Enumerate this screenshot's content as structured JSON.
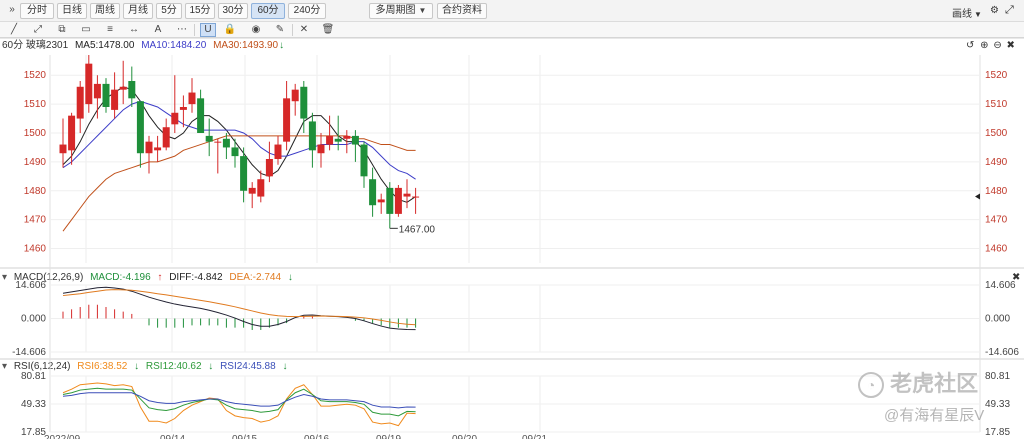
{
  "toolbar": {
    "collapse_icon": "double-chevron-right-icon",
    "periods": [
      "分时",
      "日线",
      "周线",
      "月线",
      "5分",
      "15分",
      "30分",
      "60分",
      "240分"
    ],
    "active_period": "60分",
    "multi_cycle_label": "多周期图",
    "contract_info_label": "合约资料",
    "draw_label": "画线",
    "right_icons": [
      "settings-icon",
      "expand-icon"
    ]
  },
  "drawing_tools": [
    {
      "name": "line-tool-icon",
      "glyph": "╱"
    },
    {
      "name": "ray-tool-icon",
      "glyph": "⤢"
    },
    {
      "name": "channel-tool-icon",
      "glyph": "⧉"
    },
    {
      "name": "rect-tool-icon",
      "glyph": "▭"
    },
    {
      "name": "fib-tool-icon",
      "glyph": "≡"
    },
    {
      "name": "width-tool-icon",
      "glyph": "↔"
    },
    {
      "name": "text-tool-icon",
      "glyph": "A"
    },
    {
      "name": "more-tool-icon",
      "glyph": "⋯"
    },
    {
      "name": "magnet-tool-icon",
      "glyph": "U"
    },
    {
      "name": "lock-tool-icon",
      "glyph": "🔒"
    },
    {
      "name": "eye-tool-icon",
      "glyph": "◉"
    },
    {
      "name": "pen-tool-icon",
      "glyph": "✎"
    },
    {
      "name": "hide-tool-icon",
      "glyph": "✕"
    },
    {
      "name": "delete-tool-icon",
      "glyph": "🗑"
    }
  ],
  "main_panel": {
    "label": "60分 玻璃2301",
    "ma5": "MA5:1478.00",
    "ma10": "MA10:1484.20",
    "ma30": "MA30:1493.90",
    "min_label": "1467.00"
  },
  "macd_panel": {
    "label": "MACD(12,26,9)",
    "macd": "MACD:-4.196",
    "diff": "DIFF:-4.842",
    "dea": "DEA:-2.744",
    "ticks": [
      "14.606",
      "0.000",
      "-14.606"
    ]
  },
  "rsi_panel": {
    "label": "RSI(6,12,24)",
    "rsi6": "RSI6:38.52",
    "rsi12": "RSI12:40.62",
    "rsi24": "RSI24:45.88",
    "ticks": [
      "80.81",
      "49.33",
      "17.85"
    ]
  },
  "watermark": {
    "brand": "老虎社区",
    "user": "@有海有星辰V"
  },
  "colors": {
    "up": "#d62828",
    "down": "#1e8f3a",
    "ma5": "#222222",
    "ma10": "#3d3dc8",
    "ma30": "#c0501a",
    "diff": "#222233",
    "dea": "#e07a1f",
    "rsi6": "#f08a1c",
    "rsi12": "#2e9a3a",
    "rsi24": "#3b4fb8"
  },
  "chart_data": [
    {
      "type": "candlestick",
      "title": "60分 玻璃2301",
      "y_ticks": [
        1460,
        1470,
        1480,
        1490,
        1500,
        1510,
        1520
      ],
      "ylim": [
        1455,
        1527
      ],
      "grid": true,
      "x_tick_labels": [
        "2022/09",
        "09/14",
        "09/15",
        "09/16",
        "09/19",
        "09/20",
        "09/21"
      ],
      "candles": [
        {
          "o": 1493,
          "h": 1505,
          "l": 1488,
          "c": 1496
        },
        {
          "o": 1494,
          "h": 1507,
          "l": 1489,
          "c": 1506
        },
        {
          "o": 1505,
          "h": 1518,
          "l": 1500,
          "c": 1516
        },
        {
          "o": 1510,
          "h": 1527,
          "l": 1507,
          "c": 1524
        },
        {
          "o": 1512,
          "h": 1520,
          "l": 1505,
          "c": 1517
        },
        {
          "o": 1517,
          "h": 1519,
          "l": 1507,
          "c": 1509
        },
        {
          "o": 1508,
          "h": 1521,
          "l": 1505,
          "c": 1515
        },
        {
          "o": 1515,
          "h": 1525,
          "l": 1510,
          "c": 1516
        },
        {
          "o": 1518,
          "h": 1523,
          "l": 1509,
          "c": 1512
        },
        {
          "o": 1511,
          "h": 1508,
          "l": 1488,
          "c": 1493
        },
        {
          "o": 1493,
          "h": 1499,
          "l": 1486,
          "c": 1497
        },
        {
          "o": 1494,
          "h": 1499,
          "l": 1490,
          "c": 1495
        },
        {
          "o": 1495,
          "h": 1505,
          "l": 1494,
          "c": 1502
        },
        {
          "o": 1503,
          "h": 1520,
          "l": 1500,
          "c": 1507
        },
        {
          "o": 1508,
          "h": 1513,
          "l": 1502,
          "c": 1509
        },
        {
          "o": 1510,
          "h": 1519,
          "l": 1507,
          "c": 1514
        },
        {
          "o": 1512,
          "h": 1515,
          "l": 1500,
          "c": 1500
        },
        {
          "o": 1499,
          "h": 1505,
          "l": 1492,
          "c": 1497
        },
        {
          "o": 1497,
          "h": 1498,
          "l": 1486,
          "c": 1497
        },
        {
          "o": 1498,
          "h": 1500,
          "l": 1491,
          "c": 1495
        },
        {
          "o": 1495,
          "h": 1498,
          "l": 1488,
          "c": 1492
        },
        {
          "o": 1492,
          "h": 1495,
          "l": 1476,
          "c": 1480
        },
        {
          "o": 1479,
          "h": 1483,
          "l": 1474,
          "c": 1481
        },
        {
          "o": 1478,
          "h": 1487,
          "l": 1476,
          "c": 1484
        },
        {
          "o": 1485,
          "h": 1497,
          "l": 1483,
          "c": 1491
        },
        {
          "o": 1491,
          "h": 1499,
          "l": 1489,
          "c": 1496
        },
        {
          "o": 1497,
          "h": 1518,
          "l": 1494,
          "c": 1512
        },
        {
          "o": 1511,
          "h": 1517,
          "l": 1506,
          "c": 1515
        },
        {
          "o": 1516,
          "h": 1518,
          "l": 1500,
          "c": 1505
        },
        {
          "o": 1504,
          "h": 1507,
          "l": 1488,
          "c": 1494
        },
        {
          "o": 1493,
          "h": 1500,
          "l": 1488,
          "c": 1496
        },
        {
          "o": 1496,
          "h": 1506,
          "l": 1494,
          "c": 1499
        },
        {
          "o": 1498,
          "h": 1506,
          "l": 1494,
          "c": 1497
        },
        {
          "o": 1498,
          "h": 1501,
          "l": 1493,
          "c": 1499
        },
        {
          "o": 1499,
          "h": 1501,
          "l": 1490,
          "c": 1496
        },
        {
          "o": 1496,
          "h": 1497,
          "l": 1481,
          "c": 1485
        },
        {
          "o": 1484,
          "h": 1488,
          "l": 1471,
          "c": 1475
        },
        {
          "o": 1476,
          "h": 1479,
          "l": 1472,
          "c": 1477
        },
        {
          "o": 1481,
          "h": 1483,
          "l": 1467,
          "c": 1472
        },
        {
          "o": 1472,
          "h": 1482,
          "l": 1471,
          "c": 1481
        },
        {
          "o": 1478,
          "h": 1484,
          "l": 1474,
          "c": 1479
        },
        {
          "o": 1478,
          "h": 1481,
          "l": 1472,
          "c": 1478
        }
      ],
      "series": [
        {
          "name": "MA5",
          "values": [
            1489,
            1492,
            1497,
            1503,
            1508,
            1512,
            1514,
            1516,
            1515,
            1511,
            1506,
            1502,
            1499,
            1498,
            1500,
            1504,
            1506,
            1506,
            1504,
            1501,
            1497,
            1493,
            1489,
            1486,
            1485,
            1487,
            1492,
            1498,
            1504,
            1506,
            1506,
            1503,
            1499,
            1497,
            1497,
            1494,
            1489,
            1484,
            1480,
            1477,
            1476,
            1478
          ]
        },
        {
          "name": "MA10",
          "values": [
            1488,
            1490,
            1493,
            1496,
            1499,
            1502,
            1505,
            1508,
            1510,
            1511,
            1510,
            1509,
            1507,
            1505,
            1503,
            1502,
            1501,
            1501,
            1501,
            1501,
            1501,
            1500,
            1498,
            1495,
            1493,
            1492,
            1492,
            1493,
            1494,
            1495,
            1496,
            1496,
            1496,
            1496,
            1497,
            1497,
            1495,
            1492,
            1489,
            1487,
            1486,
            1484
          ]
        },
        {
          "name": "MA30",
          "values": [
            1466,
            1470,
            1474,
            1478,
            1481,
            1484,
            1486,
            1487,
            1488,
            1489,
            1490,
            1490,
            1491,
            1492,
            1494,
            1495,
            1496,
            1497,
            1498,
            1499,
            1499,
            1499,
            1499,
            1499,
            1499,
            1499,
            1499,
            1499,
            1499,
            1499,
            1499,
            1499,
            1499,
            1499,
            1498,
            1498,
            1497,
            1496,
            1496,
            1495,
            1494,
            1494
          ]
        }
      ]
    },
    {
      "type": "macd",
      "title": "MACD(12,26,9)",
      "ylim": [
        -14.606,
        14.606
      ],
      "y_ticks": [
        14.606,
        0.0,
        -14.606
      ],
      "hist": [
        3,
        4,
        5,
        6,
        6,
        5,
        4,
        3,
        2,
        0,
        -3,
        -4,
        -4,
        -4,
        -4,
        -3,
        -3,
        -3,
        -3,
        -4,
        -4,
        -4,
        -5,
        -5,
        -4,
        -3,
        -2,
        0,
        1,
        1,
        0,
        0,
        0,
        0,
        -1,
        -1,
        -2,
        -3,
        -4,
        -4,
        -4,
        -4
      ],
      "series": [
        {
          "name": "DIFF",
          "values": [
            11,
            11.6,
            12.2,
            12.8,
            13.4,
            13.6,
            13.3,
            12.8,
            11.9,
            10.6,
            9.3,
            8.2,
            7.2,
            6.3,
            5.6,
            5,
            4.4,
            3.6,
            2.6,
            1.5,
            0.2,
            -1.3,
            -2.6,
            -3.4,
            -3.4,
            -2.6,
            -1.3,
            0.4,
            1.4,
            1.5,
            1.2,
            1.0,
            0.8,
            0.5,
            0,
            -1,
            -2.2,
            -3.3,
            -4.2,
            -4.6,
            -4.8,
            -4.84
          ]
        },
        {
          "name": "DEA",
          "values": [
            10,
            10.4,
            10.8,
            11.4,
            11.9,
            12.4,
            12.6,
            12.5,
            12.3,
            11.9,
            11.4,
            10.8,
            10.3,
            9.7,
            9.1,
            8.5,
            7.9,
            7.3,
            6.6,
            5.9,
            5.1,
            4.2,
            3.3,
            2.4,
            1.7,
            1.2,
            0.9,
            0.8,
            0.9,
            1.0,
            1.1,
            1.0,
            0.9,
            0.8,
            0.6,
            0.3,
            -0.2,
            -0.8,
            -1.5,
            -2.1,
            -2.5,
            -2.744
          ]
        }
      ]
    },
    {
      "type": "rsi",
      "title": "RSI(6,12,24)",
      "ylim": [
        17.85,
        80.81
      ],
      "y_ticks": [
        80.81,
        49.33,
        17.85
      ],
      "series": [
        {
          "name": "RSI6",
          "values": [
            62,
            66,
            71,
            72,
            73,
            72,
            70,
            71,
            69,
            46,
            30,
            30,
            28,
            33,
            42,
            48,
            52,
            56,
            55,
            42,
            36,
            34,
            33,
            29,
            31,
            36,
            55,
            67,
            71,
            60,
            47,
            47,
            48,
            49,
            48,
            44,
            29,
            27,
            28,
            25,
            39,
            38.52
          ]
        },
        {
          "name": "RSI12",
          "values": [
            60,
            62,
            65,
            66,
            67,
            66,
            66,
            66,
            65,
            55,
            45,
            43,
            42,
            44,
            48,
            51,
            53,
            55,
            54,
            48,
            44,
            43,
            42,
            40,
            41,
            43,
            54,
            62,
            66,
            60,
            53,
            52,
            52,
            52,
            51,
            49,
            40,
            38,
            38,
            36,
            41,
            40.62
          ]
        },
        {
          "name": "RSI24",
          "values": [
            58,
            59,
            61,
            62,
            62,
            62,
            62,
            62,
            62,
            58,
            53,
            51,
            50,
            50,
            52,
            53,
            54,
            55,
            55,
            52,
            50,
            49,
            48,
            47,
            47,
            48,
            53,
            57,
            60,
            58,
            55,
            54,
            54,
            54,
            53,
            52,
            48,
            46,
            46,
            45,
            46,
            45.88
          ]
        }
      ]
    }
  ]
}
